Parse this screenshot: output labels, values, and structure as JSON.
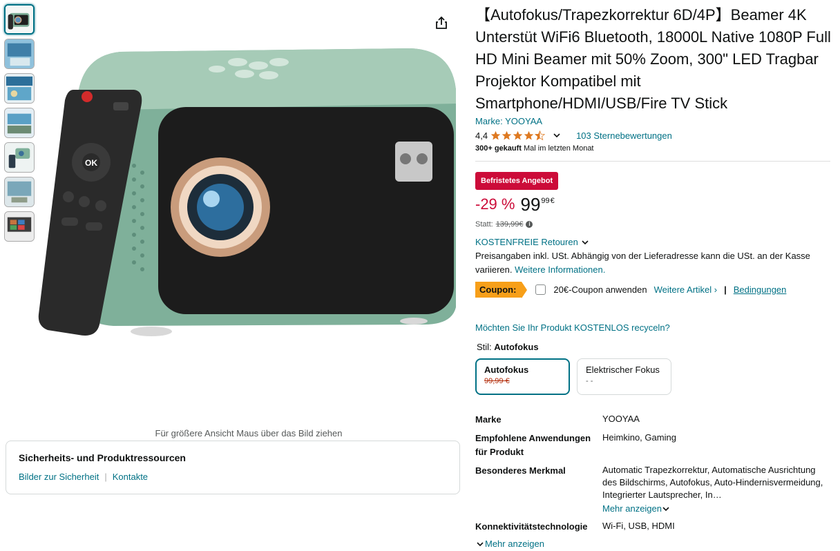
{
  "gallery": {
    "thumbnails": [
      {
        "label": "thumb-1"
      },
      {
        "label": "thumb-2"
      },
      {
        "label": "thumb-3"
      },
      {
        "label": "thumb-4"
      },
      {
        "label": "thumb-5"
      },
      {
        "label": "thumb-6"
      },
      {
        "label": "thumb-7"
      }
    ],
    "hover_hint": "Für größere Ansicht Maus über das Bild ziehen",
    "share_icon": "share-icon"
  },
  "safety": {
    "title": "Sicherheits- und Produktressourcen",
    "link1": "Bilder zur Sicherheit",
    "link2": "Kontakte"
  },
  "product": {
    "title": "【Autofokus/Trapezkorrektur 6D/4P】Beamer 4K Unterstüt WiFi6 Bluetooth, 18000L Native 1080P Full HD Mini Beamer mit 50% Zoom, 300\" LED Tragbar Projektor Kompatibel mit Smartphone/HDMI/USB/Fire TV Stick",
    "brand_link": "Marke: YOOYAA",
    "rating": "4,4",
    "rating_count": "103 Sternebewertungen",
    "bought_bold": "300+ gekauft",
    "bought_rest": " Mal im letzten Monat"
  },
  "pricing": {
    "deal_badge": "Befristetes Angebot",
    "discount": "-29 %",
    "price_whole": "99",
    "price_fraction": "99",
    "currency": "€",
    "was_label": "Statt:",
    "was_price": "139,99€",
    "returns": "KOSTENFREIE Retouren",
    "vat_text": "Preisangaben inkl. USt. Abhängig von der Lieferadresse kann die USt. an der Kasse variieren.",
    "vat_link": "Weitere Informationen."
  },
  "coupon": {
    "tag": "Coupon:",
    "text": "20€-Coupon anwenden",
    "more": "Weitere Artikel ›",
    "terms": "Bedingungen"
  },
  "recycle": "Möchten Sie Ihr Produkt KOSTENLOS recyceln?",
  "style": {
    "label": "Stil:",
    "selected": "Autofokus",
    "options": [
      {
        "name": "Autofokus",
        "price": "99,99 €"
      },
      {
        "name": "Elektrischer Fokus",
        "price": "- -"
      }
    ]
  },
  "specs": [
    {
      "key": "Marke",
      "value": "YOOYAA"
    },
    {
      "key": "Empfohlene Anwendungen für Produkt",
      "value": "Heimkino, Gaming"
    },
    {
      "key": "Besonderes Merkmal",
      "value": "Automatic Trapezkorrektur, Automatische Ausrichtung des Bildschirms, Autofokus, Auto-Hindernisvermeidung, Integrierter Lautsprecher, In…"
    },
    {
      "key": "Konnektivitätstechnologie",
      "value": "Wi-Fi, USB, HDMI"
    }
  ],
  "spec_more_inline": "Mehr anzeigen",
  "spec_more_bottom": "Mehr anzeigen",
  "colors": {
    "link": "#007185",
    "deal": "#cc0c39",
    "coupon": "#f79f19",
    "projector_body": "#7fb09a"
  }
}
